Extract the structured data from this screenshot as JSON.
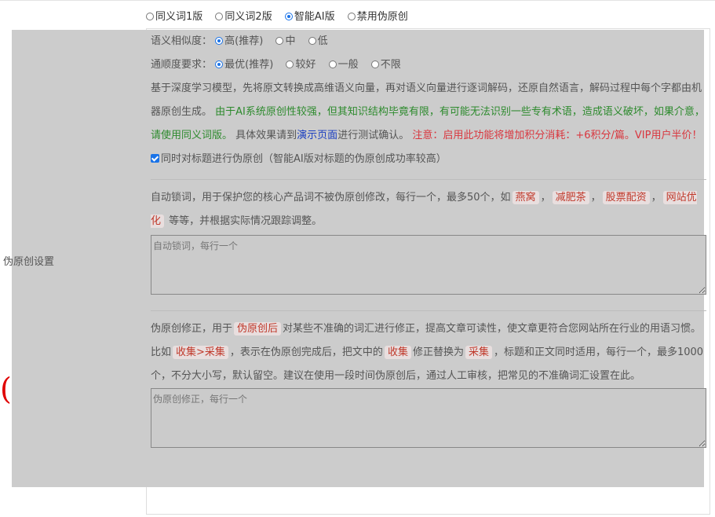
{
  "mode_options": [
    {
      "label": "同义词1版",
      "checked": false
    },
    {
      "label": "同义词2版",
      "checked": false
    },
    {
      "label": "智能AI版",
      "checked": true
    },
    {
      "label": "禁用伪原创",
      "checked": false
    }
  ],
  "section_label": "伪原创设置",
  "similarity": {
    "label": "语义相似度：",
    "options": [
      {
        "label": "高(推荐)",
        "checked": true
      },
      {
        "label": "中",
        "checked": false
      },
      {
        "label": "低",
        "checked": false
      }
    ]
  },
  "fluency": {
    "label": "通顺度要求：",
    "options": [
      {
        "label": "最优(推荐)",
        "checked": true
      },
      {
        "label": "较好",
        "checked": false
      },
      {
        "label": "一般",
        "checked": false
      },
      {
        "label": "不限",
        "checked": false
      }
    ]
  },
  "description": {
    "intro": "基于深度学习模型，先将原文转换成高维语义向量，再对语义向量进行逐词解码，还原自然语言，解码过程中每个字都由机器原创生成。",
    "warning_green": "由于AI系统原创性较强，但其知识结构毕竟有限，有可能无法识别一些专有术语，造成语义破坏，如果介意，请使用同义词版。",
    "effect_prefix": "具体效果请到",
    "demo_link": "演示页面",
    "effect_suffix": "进行测试确认。",
    "notice_red": "注意：启用此功能将增加积分消耗：+6积分/篇。VIP用户半价！"
  },
  "title_checkbox": {
    "label": "同时对标题进行伪原创（智能AI版对标题的伪原创成功率较高）",
    "checked": true
  },
  "lock_words": {
    "intro": "自动锁词，用于保护您的核心产品词不被伪原创修改，每行一个，最多50个，如",
    "examples": [
      "燕窝",
      "减肥茶",
      "股票配资",
      "网站优化"
    ],
    "sep": "，",
    "suffix": "等等，并根据实际情况跟踪调整。",
    "placeholder": "自动锁词，每行一个"
  },
  "correction": {
    "p1": "伪原创修正，用于",
    "kw1": "伪原创后",
    "p2": "对某些不准确的词汇进行修正，提高文章可读性，使文章更符合您网站所在行业的用语习惯。比如",
    "kw2": "收集>采集",
    "p3": "，表示在伪原创完成后，把文中的",
    "kw3": "收集",
    "p4": "修正替换为",
    "kw4": "采集",
    "p5": "，标题和正文同时适用，每行一个，最多1000个，不分大小写，默认留空。建议在使用一段时间伪原创后，通过人工审核，把常见的不准确词汇设置在此。",
    "placeholder": "伪原创修正，每行一个"
  },
  "paren": "(",
  "colors": {
    "panel": "#cccccc",
    "accent": "#1a73e8",
    "green": "#2d8a2d",
    "red": "#d9363e",
    "link": "#1a3ec0"
  }
}
